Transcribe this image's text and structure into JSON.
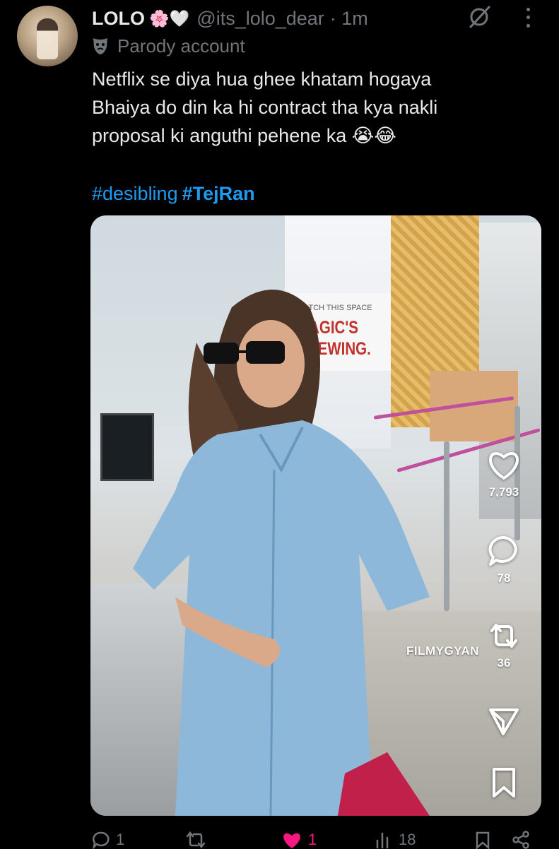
{
  "tweet": {
    "author_name": "LOLO",
    "author_emojis": "🌸🤍",
    "handle": "@its_lolo_dear",
    "time": "· 1m",
    "label": "Parody account",
    "text": "Netflix se diya hua ghee khatam hogaya\nBhaiya do din ka hi contract tha kya nakli\nproposal ki anguthi pehene ka 😭😂",
    "hashtags": [
      "#desibling",
      "#TejRan"
    ]
  },
  "video": {
    "sign_small": "WATCH THIS SPACE",
    "sign_big": "MAGIC'S\nBREWING.",
    "watermark": "FILMYGYAN",
    "rail": {
      "likes": "7,793",
      "comments": "78",
      "reposts": "36",
      "icons": [
        "heart-icon",
        "comment-bubble-icon",
        "repost-icon",
        "share-icon",
        "bookmark-icon"
      ]
    }
  },
  "actions": {
    "replies": "1",
    "reposts": "",
    "likes": "1",
    "views": "18"
  },
  "colors": {
    "background": "#000000",
    "text": "#e7e9ea",
    "muted": "#71767b",
    "hashtag": "#1d9bf0",
    "like": "#f91880"
  }
}
